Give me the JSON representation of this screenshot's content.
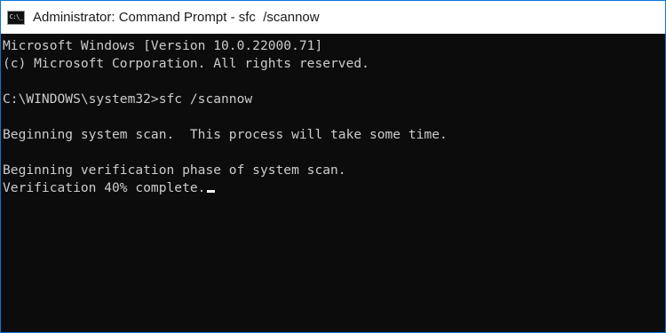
{
  "window": {
    "title": "Administrator: Command Prompt - sfc  /scannow",
    "icon": "command-prompt-icon",
    "icon_glyph": "C:\\_",
    "border_color": "#0a74d8",
    "console_background": "#0c0c0c",
    "console_text_color": "#cccccc"
  },
  "console": {
    "header_line1": "Microsoft Windows [Version 10.0.22000.71]",
    "header_line2": "(c) Microsoft Corporation. All rights reserved.",
    "prompt_command": "C:\\WINDOWS\\system32>sfc /scannow",
    "scan_begin": "Beginning system scan.  This process will take some time.",
    "verification_begin": "Beginning verification phase of system scan.",
    "verification_progress": "Verification 40% complete."
  }
}
